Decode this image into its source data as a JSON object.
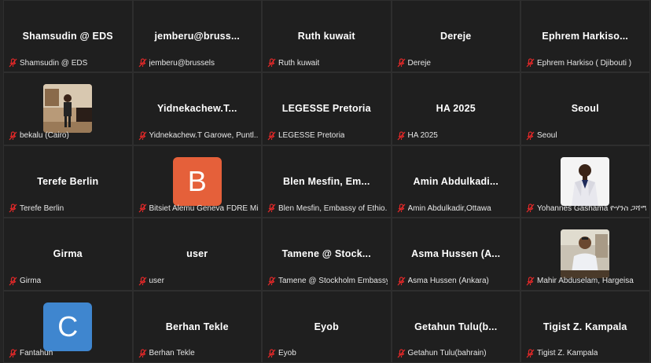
{
  "gallery": {
    "tiles": [
      {
        "title": "Shamsudin @ EDS",
        "name": "Shamsudin @ EDS",
        "kind": "name"
      },
      {
        "title": "jemberu@bruss...",
        "name": "jemberu@brussels",
        "kind": "name"
      },
      {
        "title": "Ruth kuwait",
        "name": "Ruth kuwait",
        "kind": "name"
      },
      {
        "title": "Dereje",
        "name": "Dereje",
        "kind": "name"
      },
      {
        "title": "Ephrem  Harkiso...",
        "name": "Ephrem Harkiso ( Djibouti )",
        "kind": "name"
      },
      {
        "title": "",
        "name": "bekalu (Cairo)",
        "kind": "photo",
        "photo": "man-standing-room"
      },
      {
        "title": "Yidnekachew.T...",
        "name": "Yidnekachew.T Garowe, Puntl...",
        "kind": "name"
      },
      {
        "title": "LEGESSE Pretoria",
        "name": "LEGESSE Pretoria",
        "kind": "name"
      },
      {
        "title": "HA 2025",
        "name": "HA 2025",
        "kind": "name"
      },
      {
        "title": "Seoul",
        "name": "Seoul",
        "kind": "name"
      },
      {
        "title": "Terefe Berlin",
        "name": "Terefe Berlin",
        "kind": "name"
      },
      {
        "title": "",
        "name": "Bitsiet Alemu Geneva FDRE Mi...",
        "kind": "avatar",
        "letter": "B",
        "color": "#e5603a"
      },
      {
        "title": "Blen Mesfin,  Em...",
        "name": "Blen Mesfin, Embassy of Ethio...",
        "kind": "name"
      },
      {
        "title": "Amin  Abdulkadi...",
        "name": "Amin Abdulkadir,Ottawa",
        "kind": "name"
      },
      {
        "title": "",
        "name": "Yohannes Gashama ዮሃንስ ጋሻማ",
        "kind": "photo",
        "photo": "man-white-suit"
      },
      {
        "title": "Girma",
        "name": "Girma",
        "kind": "name"
      },
      {
        "title": "user",
        "name": "user",
        "kind": "name"
      },
      {
        "title": "Tamene  @  Stock...",
        "name": "Tamene @ Stockholm Embassy",
        "kind": "name"
      },
      {
        "title": "Asma Hussen (A...",
        "name": "Asma Hussen (Ankara)",
        "kind": "name"
      },
      {
        "title": "",
        "name": "Mahir Abduselam, Hargeisa",
        "kind": "photo",
        "photo": "man-office"
      },
      {
        "title": "",
        "name": "Fantahun",
        "kind": "avatar",
        "letter": "C",
        "color": "#3f86cf"
      },
      {
        "title": "Berhan Tekle",
        "name": "Berhan Tekle",
        "kind": "name"
      },
      {
        "title": "Eyob",
        "name": "Eyob",
        "kind": "name"
      },
      {
        "title": "Getahun  Tulu(b...",
        "name": "Getahun Tulu(bahrain)",
        "kind": "name"
      },
      {
        "title": "Tigist Z. Kampala",
        "name": "Tigist Z. Kampala",
        "kind": "name"
      }
    ],
    "mic_icon": "mic-muted-icon",
    "mic_color": "#e02828"
  }
}
